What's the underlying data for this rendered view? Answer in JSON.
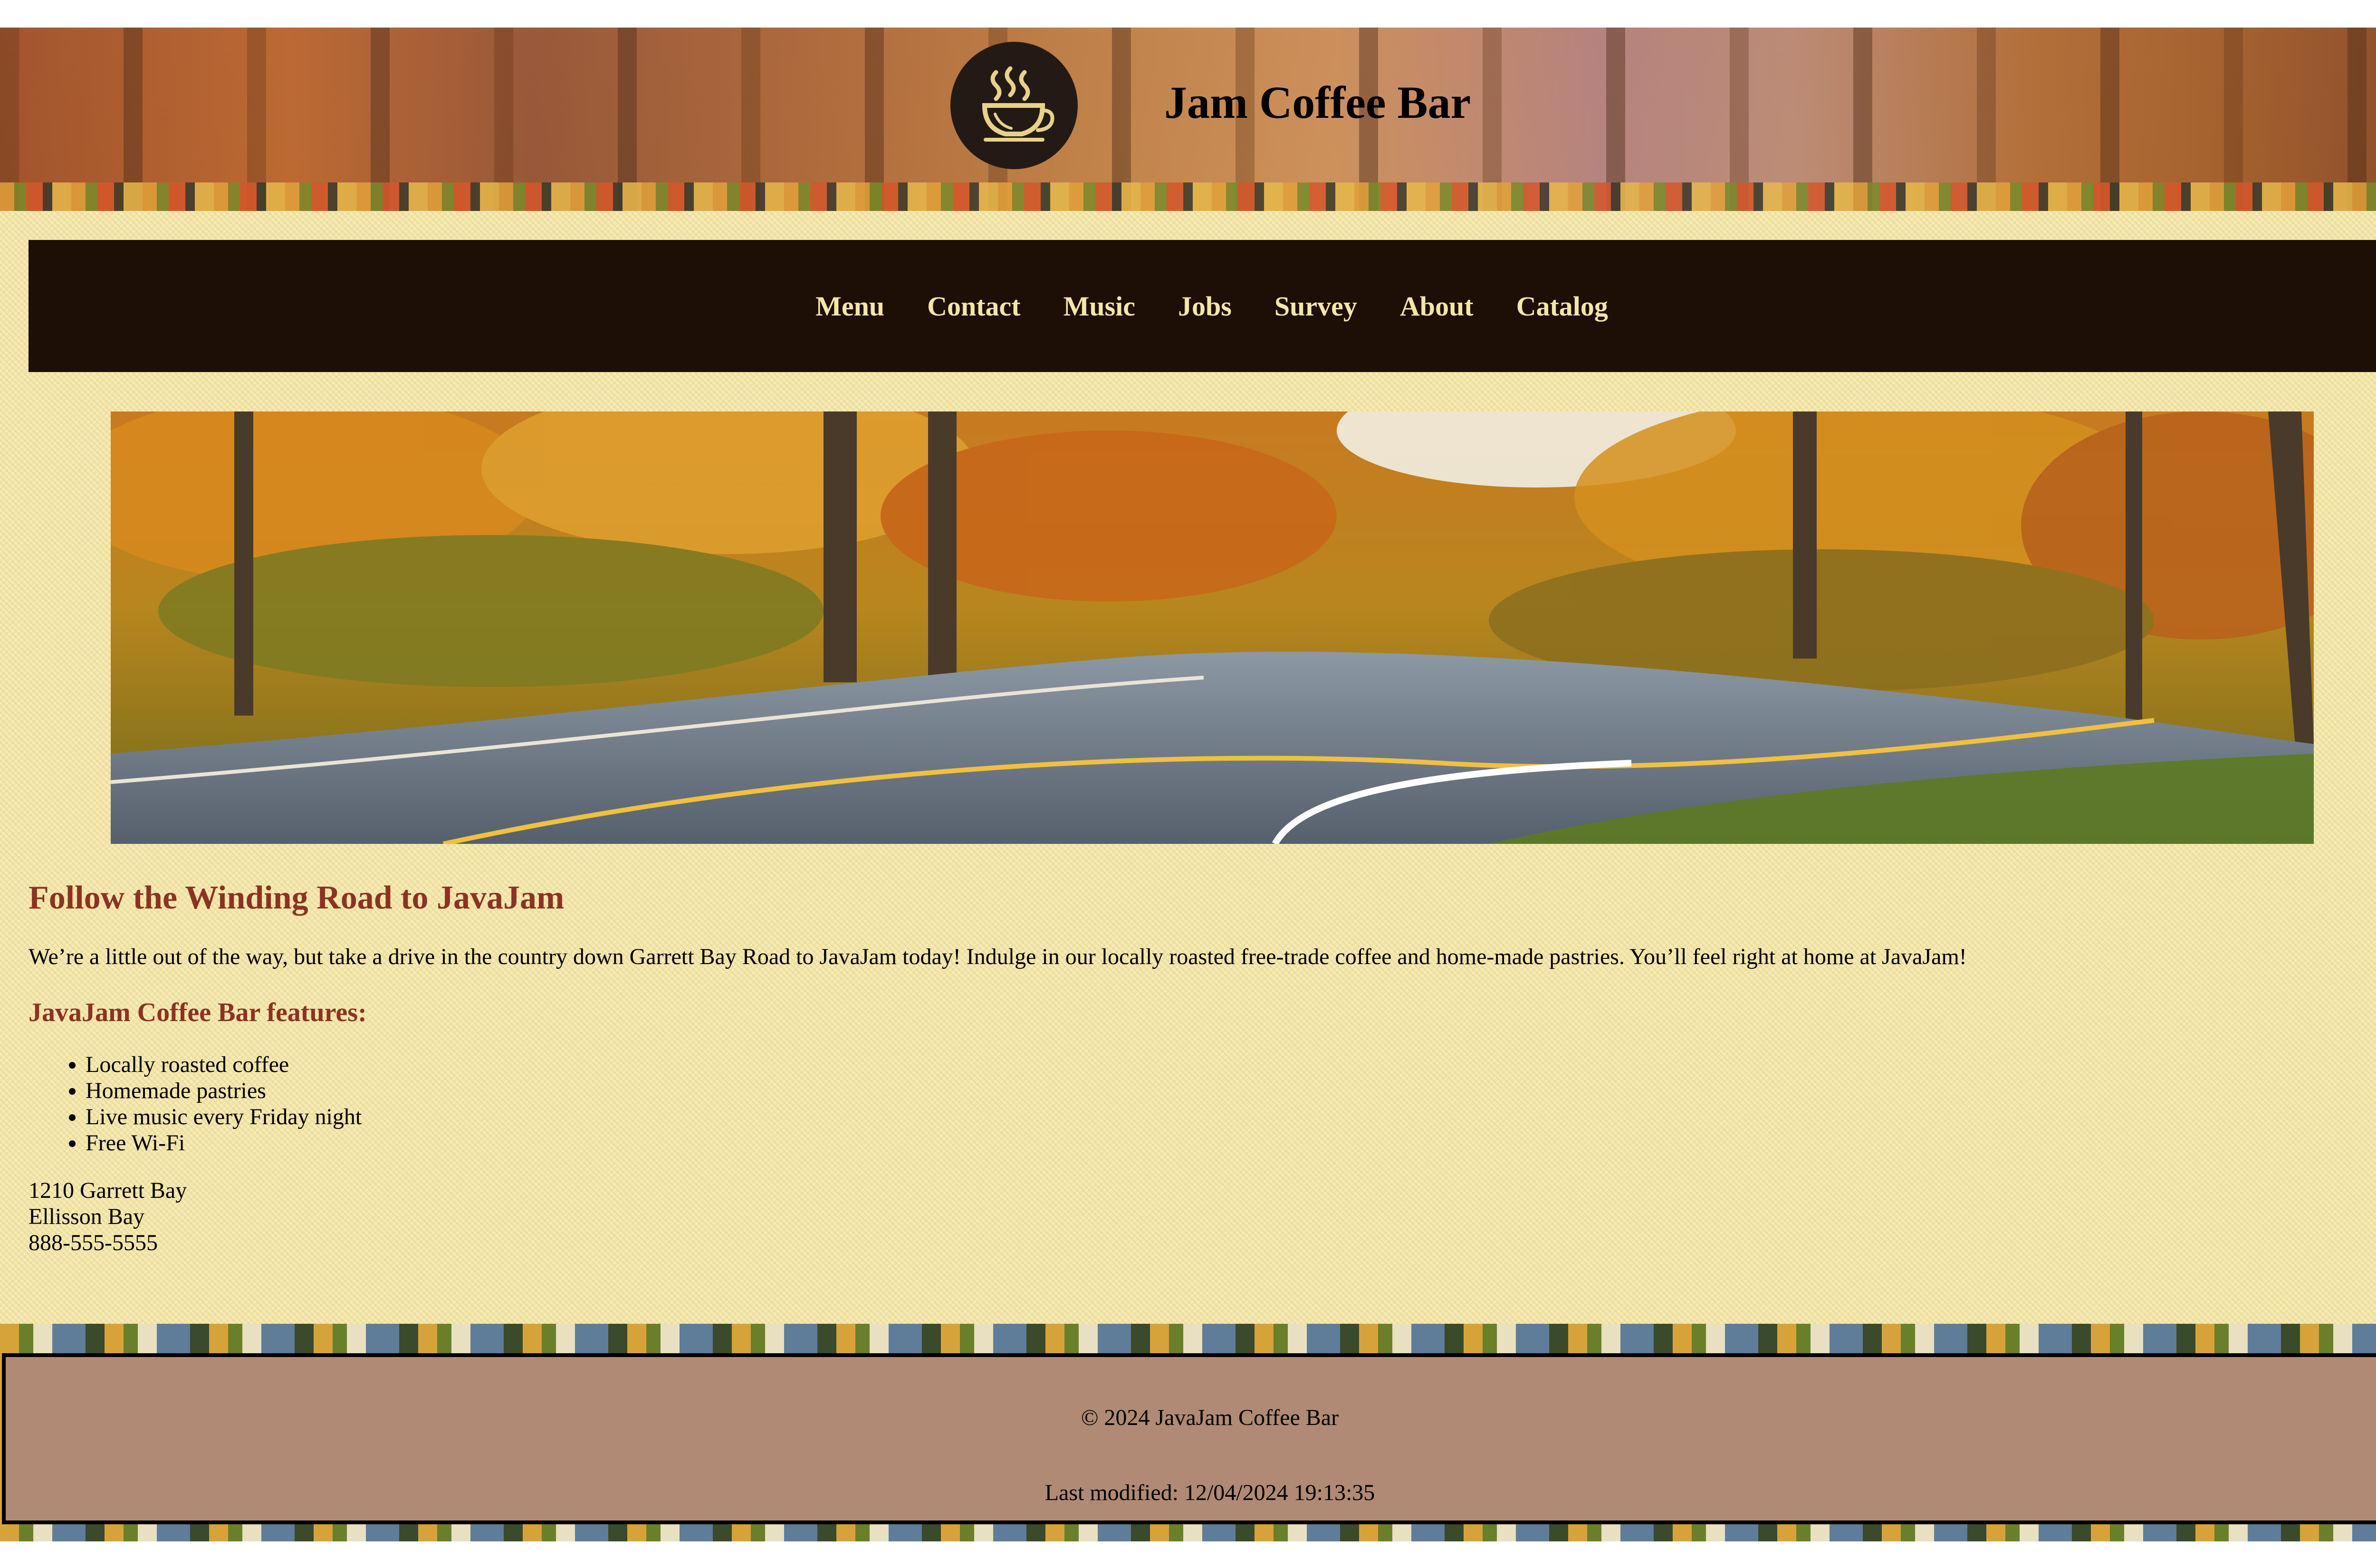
{
  "header": {
    "title": "Jam Coffee Bar",
    "logo_icon": "coffee-cup-icon"
  },
  "nav": {
    "items": [
      {
        "label": "Menu"
      },
      {
        "label": "Contact"
      },
      {
        "label": "Music"
      },
      {
        "label": "Jobs"
      },
      {
        "label": "Survey"
      },
      {
        "label": "About"
      },
      {
        "label": "Catalog"
      }
    ]
  },
  "hero": {
    "image": "winding-road-autumn-forest"
  },
  "content": {
    "heading": "Follow the Winding Road to JavaJam",
    "intro": "We’re a little out of the way, but take a drive in the country down Garrett Bay Road to JavaJam today! Indulge in our locally roasted free-trade coffee and home-made pastries. You’ll feel right at home at JavaJam!",
    "features_heading": "JavaJam Coffee Bar features:",
    "features": [
      "Locally roasted coffee",
      "Homemade pastries",
      "Live music every Friday night",
      "Free Wi-Fi"
    ],
    "address": {
      "line1": "1210 Garrett Bay",
      "line2": "Ellisson Bay",
      "phone": "888-555-5555"
    }
  },
  "footer": {
    "copyright": "© 2024 JavaJam Coffee Bar",
    "last_modified": "Last modified: 12/04/2024 19:13:35"
  },
  "colors": {
    "cream_background": "#f3e6a8",
    "nav_background": "#1d0f05",
    "nav_text": "#f3e6a8",
    "heading_color": "#8b3323",
    "footer_background": "#b08a74"
  }
}
